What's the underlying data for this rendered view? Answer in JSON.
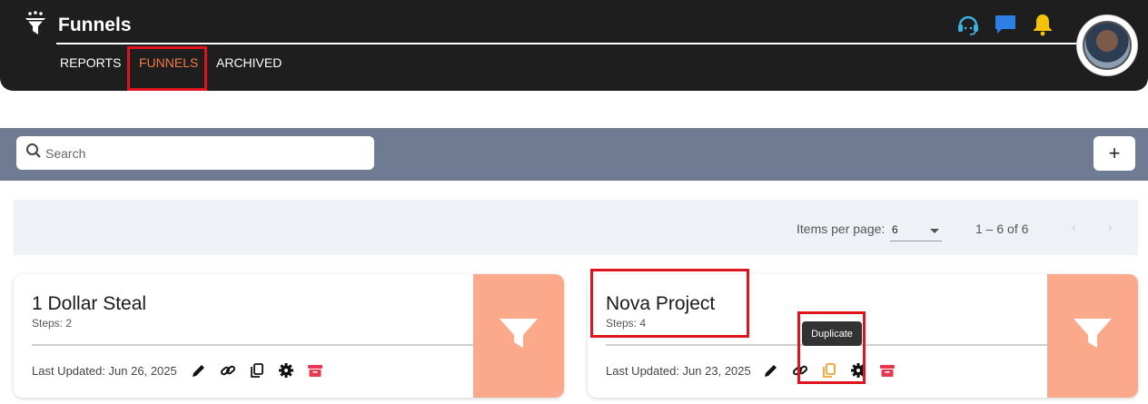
{
  "header": {
    "title": "Funnels",
    "tabs": [
      {
        "label": "REPORTS"
      },
      {
        "label": "FUNNELS",
        "active": true
      },
      {
        "label": "ARCHIVED"
      }
    ],
    "icons": [
      "support-headset-icon",
      "chat-icon",
      "notification-bell-icon",
      "user-avatar"
    ]
  },
  "toolbar": {
    "search_placeholder": "Search",
    "add_label": "+"
  },
  "paginator": {
    "items_per_page_label": "Items per page:",
    "items_per_page_value": "6",
    "range_label": "1 – 6 of 6",
    "prev_label": "‹",
    "next_label": "›"
  },
  "cards": [
    {
      "title": "1 Dollar Steal",
      "steps": "Steps: 2",
      "updated": "Last Updated: Jun 26, 2025"
    },
    {
      "title": "Nova Project",
      "steps": "Steps: 4",
      "updated": "Last Updated: Jun 23, 2025"
    }
  ],
  "tooltip": {
    "text": "Duplicate"
  },
  "colors": {
    "topbar": "#1e1e1e",
    "active_tab": "#f37a47",
    "highlight": "#e0141e",
    "search_band": "#6e7b93",
    "card_side": "#fba98a",
    "archive_icon": "#e8384f",
    "duplicate_hover": "#f0a030"
  }
}
